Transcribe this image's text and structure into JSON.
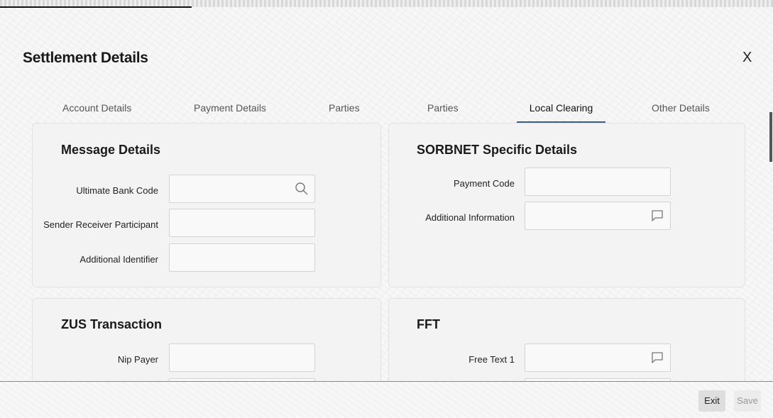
{
  "window": {
    "title": "Settlement Details",
    "close_label": "X"
  },
  "tabs": [
    {
      "label": "Account Details"
    },
    {
      "label": "Payment Details"
    },
    {
      "label": "Parties"
    },
    {
      "label": "Parties"
    },
    {
      "label": "Local Clearing",
      "active": true
    },
    {
      "label": "Other Details"
    }
  ],
  "message_details": {
    "title": "Message Details",
    "fields": [
      {
        "label": "Ultimate Bank Code",
        "value": "",
        "icon": "search-icon"
      },
      {
        "label": "Sender Receiver Participant",
        "value": ""
      },
      {
        "label": "Additional Identifier",
        "value": ""
      }
    ]
  },
  "sorbnet": {
    "title": "SORBNET Specific Details",
    "fields": [
      {
        "label": "Payment Code",
        "value": ""
      },
      {
        "label": "Additional Information",
        "value": "",
        "icon": "comment-icon"
      }
    ]
  },
  "zus": {
    "title": "ZUS Transaction",
    "fields": [
      {
        "label": "Nip Payer",
        "value": ""
      }
    ]
  },
  "fft": {
    "title": "FFT",
    "fields": [
      {
        "label": "Free Text 1",
        "value": "",
        "icon": "comment-icon"
      }
    ]
  },
  "footer": {
    "exit_label": "Exit",
    "save_label": "Save"
  },
  "colors": {
    "active_tab_underline": "#3b5d86",
    "panel_bg": "#f3f3f3"
  }
}
